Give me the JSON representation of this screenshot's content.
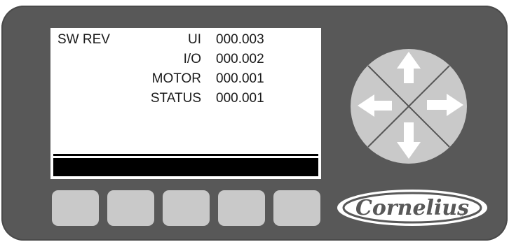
{
  "screen": {
    "title": "SW REV",
    "rows": [
      {
        "label": "UI",
        "value": "000.003"
      },
      {
        "label": "I/O",
        "value": "000.002"
      },
      {
        "label": "MOTOR",
        "value": "000.001"
      },
      {
        "label": "STATUS",
        "value": "000.001"
      }
    ]
  },
  "softkeys": [
    "",
    "",
    "",
    "",
    ""
  ],
  "dpad": {
    "buttons": [
      "up-arrow-icon",
      "down-arrow-icon",
      "left-arrow-icon",
      "right-arrow-icon"
    ]
  },
  "brand": {
    "logo_text": "Cornelius"
  },
  "colors": {
    "panel": "#585858",
    "screen": "#ffffff",
    "softkey": "#c9c9c9",
    "dpad": "#c9c9c9"
  }
}
